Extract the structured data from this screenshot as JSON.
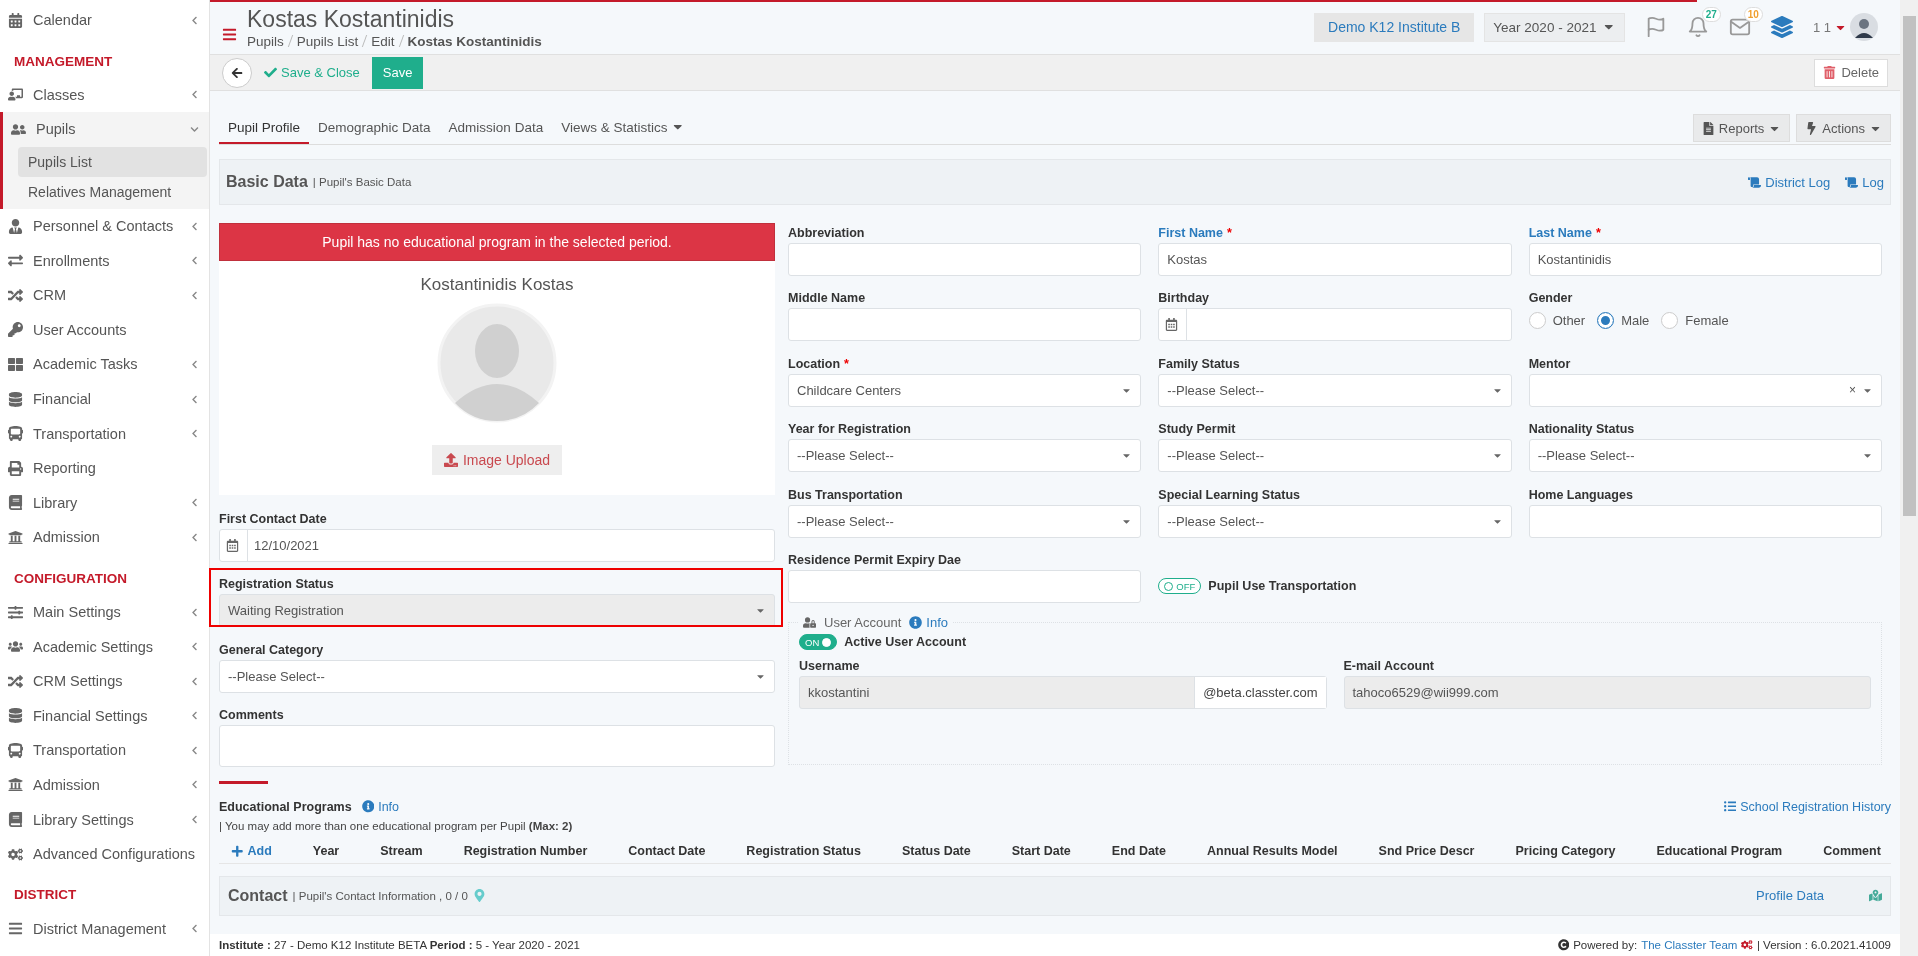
{
  "loading_bar": {
    "level": 0.88
  },
  "sidebar": {
    "items": [
      {
        "kind": "link",
        "label": "Calendar",
        "submenu": true
      },
      {
        "kind": "heading",
        "label": "MANAGEMENT"
      },
      {
        "kind": "link",
        "label": "Classes",
        "submenu": true
      },
      {
        "kind": "link",
        "label": "Pupils",
        "submenu": true,
        "expanded": true,
        "children": [
          {
            "label": "Pupils List",
            "selected": true
          },
          {
            "label": "Relatives Management",
            "selected": false
          }
        ]
      },
      {
        "kind": "link",
        "label": "Personnel & Contacts",
        "submenu": true
      },
      {
        "kind": "link",
        "label": "Enrollments",
        "submenu": true
      },
      {
        "kind": "link",
        "label": "CRM",
        "submenu": true
      },
      {
        "kind": "link",
        "label": "User Accounts",
        "submenu": false
      },
      {
        "kind": "link",
        "label": "Academic Tasks",
        "submenu": true
      },
      {
        "kind": "link",
        "label": "Financial",
        "submenu": true
      },
      {
        "kind": "link",
        "label": "Transportation",
        "submenu": true
      },
      {
        "kind": "link",
        "label": "Reporting",
        "submenu": false
      },
      {
        "kind": "link",
        "label": "Library",
        "submenu": true
      },
      {
        "kind": "link",
        "label": "Admission",
        "submenu": true
      },
      {
        "kind": "heading",
        "label": "CONFIGURATION"
      },
      {
        "kind": "link",
        "label": "Main Settings",
        "submenu": true
      },
      {
        "kind": "link",
        "label": "Academic Settings",
        "submenu": true
      },
      {
        "kind": "link",
        "label": "CRM Settings",
        "submenu": true
      },
      {
        "kind": "link",
        "label": "Financial Settings",
        "submenu": true
      },
      {
        "kind": "link",
        "label": "Transportation",
        "submenu": true
      },
      {
        "kind": "link",
        "label": "Admission",
        "submenu": true
      },
      {
        "kind": "link",
        "label": "Library Settings",
        "submenu": true
      },
      {
        "kind": "link",
        "label": "Advanced Configurations",
        "submenu": false
      },
      {
        "kind": "heading",
        "label": "DISTRICT"
      },
      {
        "kind": "link",
        "label": "District Management",
        "submenu": true
      }
    ]
  },
  "header": {
    "title": "Kostas Kostantinidis",
    "breadcrumbs": [
      "Pupils",
      "Pupils List",
      "Edit",
      "Kostas Kostantinidis"
    ],
    "institute": "Demo K12 Institute B",
    "year": "Year 2020 - 2021",
    "notifications": [
      {
        "kind": "bell",
        "count": "27",
        "color": "#1fae8c"
      },
      {
        "kind": "mail",
        "count": "10",
        "color": "#f0a030"
      }
    ],
    "user": "1 1"
  },
  "toolbar": {
    "save_close": "Save & Close",
    "save": "Save",
    "delete": "Delete"
  },
  "tabs": [
    {
      "label": "Pupil Profile",
      "selected": true,
      "menu": false
    },
    {
      "label": "Demographic Data",
      "selected": false,
      "menu": false
    },
    {
      "label": "Admission Data",
      "selected": false,
      "menu": false
    },
    {
      "label": "Views & Statistics",
      "selected": false,
      "menu": true
    }
  ],
  "tab_actions": [
    "Reports",
    "Actions"
  ],
  "basic_data": {
    "title": "Basic Data",
    "subtitle": "| Pupil's Basic Data",
    "links": [
      "District Log",
      "Log"
    ],
    "alert": "Pupil has no educational program in the selected period.",
    "full_name": "Kostantinidis Kostas",
    "upload": "Image Upload",
    "left_fields": [
      {
        "kind": "date",
        "label": "First Contact Date",
        "value": "12/10/2021",
        "accent": false
      },
      {
        "kind": "select",
        "label": "Registration Status",
        "value": "Waiting Registration",
        "accent": false,
        "highlighted": true,
        "disabled": true
      },
      {
        "kind": "select",
        "label": "General Category",
        "value": "--Please Select--",
        "accent": false
      },
      {
        "kind": "textarea",
        "label": "Comments",
        "accent": false
      }
    ],
    "fields": [
      {
        "kind": "text",
        "label": "Abbreviation",
        "accent": false
      },
      {
        "kind": "text",
        "label": "First Name",
        "value": "Kostas",
        "required_mark": "*",
        "accent": true
      },
      {
        "kind": "text",
        "label": "Last Name",
        "value": "Kostantinidis",
        "required_mark": "*",
        "accent": true
      },
      {
        "kind": "text",
        "label": "Middle Name",
        "accent": false
      },
      {
        "kind": "date",
        "label": "Birthday",
        "accent": false
      },
      {
        "kind": "radio",
        "label": "Gender",
        "accent": false,
        "options": [
          {
            "label": "Other",
            "selected": false
          },
          {
            "label": "Male",
            "selected": true
          },
          {
            "label": "Female",
            "selected": false
          }
        ]
      },
      {
        "kind": "select",
        "label": "Location",
        "value": "Childcare Centers",
        "required_mark": "*",
        "accent": false
      },
      {
        "kind": "select",
        "label": "Family Status",
        "value": "--Please Select--",
        "accent": false
      },
      {
        "kind": "clearable",
        "label": "Mentor",
        "clear": "×",
        "accent": false
      },
      {
        "kind": "select",
        "label": "Year for Registration",
        "value": "--Please Select--",
        "accent": false
      },
      {
        "kind": "select",
        "label": "Study Permit",
        "value": "--Please Select--",
        "accent": false
      },
      {
        "kind": "select",
        "label": "Nationality Status",
        "value": "--Please Select--",
        "accent": false
      },
      {
        "kind": "select",
        "label": "Bus Transportation",
        "value": "--Please Select--",
        "accent": false
      },
      {
        "kind": "select",
        "label": "Special Learning Status",
        "value": "--Please Select--",
        "accent": false
      },
      {
        "kind": "text",
        "label": "Home Languages",
        "accent": false
      },
      {
        "kind": "text",
        "label": "Residence Permit Expiry Dae",
        "accent": false
      },
      {
        "kind": "toggle",
        "label": "Pupil Use Transportation",
        "on": false,
        "text": "OFF"
      }
    ],
    "user_account": {
      "title": "User Account",
      "info": "Info",
      "toggle": {
        "label": "Active User Account",
        "on": true,
        "text": "ON"
      },
      "username_label": "Username",
      "username": "kkostantini",
      "domain": "@beta.classter.com",
      "email_label": "E-mail Account",
      "email": "tahoco6529@wii999.com"
    }
  },
  "educational_programs": {
    "title": "Educational Programs",
    "info": "Info",
    "note": "| You may add more than one educational program per Pupil **(Max: 2)**",
    "history": "School Registration History",
    "add": "Add",
    "columns": [
      "Year",
      "Stream",
      "Registration Number",
      "Contact Date",
      "Registration Status",
      "Status Date",
      "Start Date",
      "End Date",
      "Annual Results Model",
      "Snd Price Descr",
      "Pricing Category",
      "Educational Program",
      "Comment"
    ]
  },
  "contact": {
    "title": "Contact",
    "subtitle": "| Pupil's Contact Information , 0 / 0",
    "link": "Profile Data"
  },
  "footer": {
    "info": "**Institute :** 27 - Demo K12 Institute BETA **Period :** 5 - Year 2020 - 2021",
    "powered": "Powered by:",
    "team": "The Classter Team",
    "version": "| Version : 6.0.2021.41009"
  }
}
